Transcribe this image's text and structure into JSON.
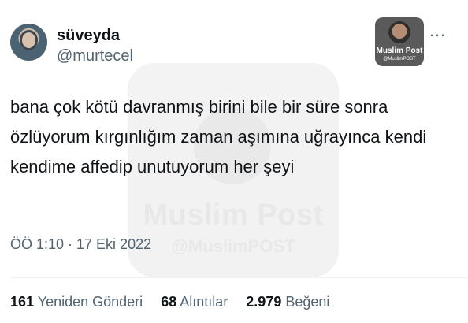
{
  "watermark": {
    "title": "Muslim Post",
    "handle": "@MuslimPOST"
  },
  "author": {
    "display_name": "süveyda",
    "handle": "@murtecel"
  },
  "badge": {
    "title": "Muslim Post",
    "handle": "@MuslimPOST"
  },
  "more_icon": "…",
  "tweet": {
    "text": "bana çok kötü davranmış birini bile bir süre sonra özlüyorum kırgınlığım zaman aşımına uğrayınca kendi kendime affedip unutuyorum her şeyi",
    "timestamp": "ÖÖ 1:10 · 17 Eki 2022"
  },
  "stats": [
    {
      "count": "161",
      "label": "Yeniden Gönderi"
    },
    {
      "count": "68",
      "label": "Alıntılar"
    },
    {
      "count": "2.979",
      "label": "Beğeni"
    }
  ]
}
